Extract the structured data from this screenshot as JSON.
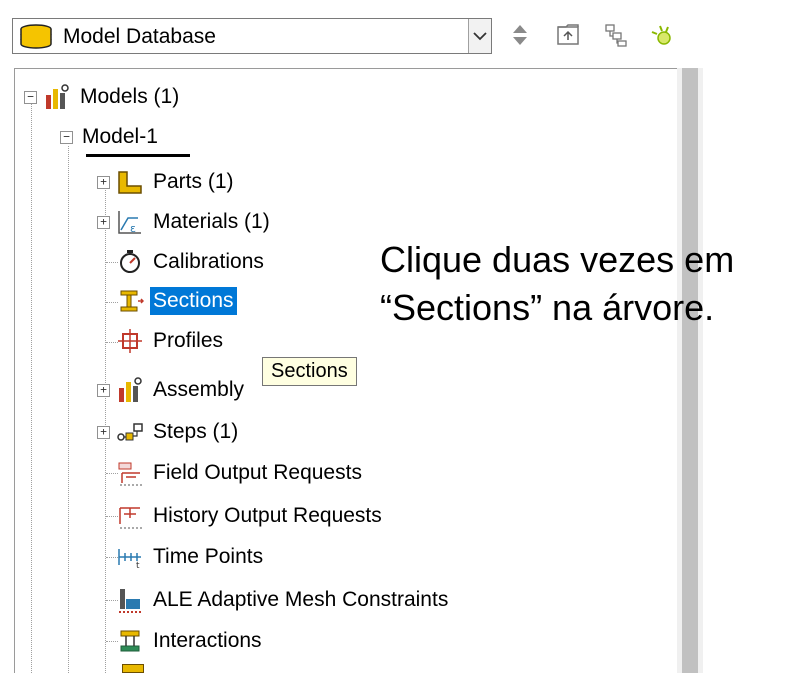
{
  "toolbar": {
    "database_select": "Model Database",
    "icons": [
      "database-icon",
      "dropdown-arrow-icon",
      "sort-updown-icon",
      "tree-parent-icon",
      "tree-expand-icon",
      "bulb-icon"
    ]
  },
  "tree": {
    "root": {
      "label": "Models (1)",
      "expander": "⊟"
    },
    "model": {
      "label": "Model-1",
      "expander": "⊟"
    },
    "items": [
      {
        "label": "Parts (1)",
        "expander": "+",
        "icon": "parts-icon"
      },
      {
        "label": "Materials (1)",
        "expander": "+",
        "icon": "materials-icon"
      },
      {
        "label": "Calibrations",
        "expander": "",
        "icon": "calibrations-icon"
      },
      {
        "label": "Sections",
        "expander": "",
        "icon": "sections-icon",
        "selected": true
      },
      {
        "label": "Profiles",
        "expander": "",
        "icon": "profiles-icon"
      },
      {
        "label": "Assembly",
        "expander": "+",
        "icon": "assembly-icon"
      },
      {
        "label": "Steps (1)",
        "expander": "+",
        "icon": "steps-icon"
      },
      {
        "label": "Field Output Requests",
        "expander": "",
        "icon": "field-output-icon"
      },
      {
        "label": "History Output Requests",
        "expander": "",
        "icon": "history-output-icon"
      },
      {
        "label": "Time Points",
        "expander": "",
        "icon": "time-points-icon"
      },
      {
        "label": "ALE Adaptive Mesh Constraints",
        "expander": "",
        "icon": "ale-mesh-icon"
      },
      {
        "label": "Interactions",
        "expander": "",
        "icon": "interactions-icon"
      }
    ]
  },
  "tooltip": {
    "text": "Sections"
  },
  "annotation": {
    "line1": "Clique duas vezes em",
    "line2": "“Sections” na árvore."
  },
  "colors": {
    "selection": "#0078d7",
    "tooltip_bg": "#ffffe1",
    "icon_yellow": "#f0c000",
    "icon_red": "#c0392b"
  }
}
